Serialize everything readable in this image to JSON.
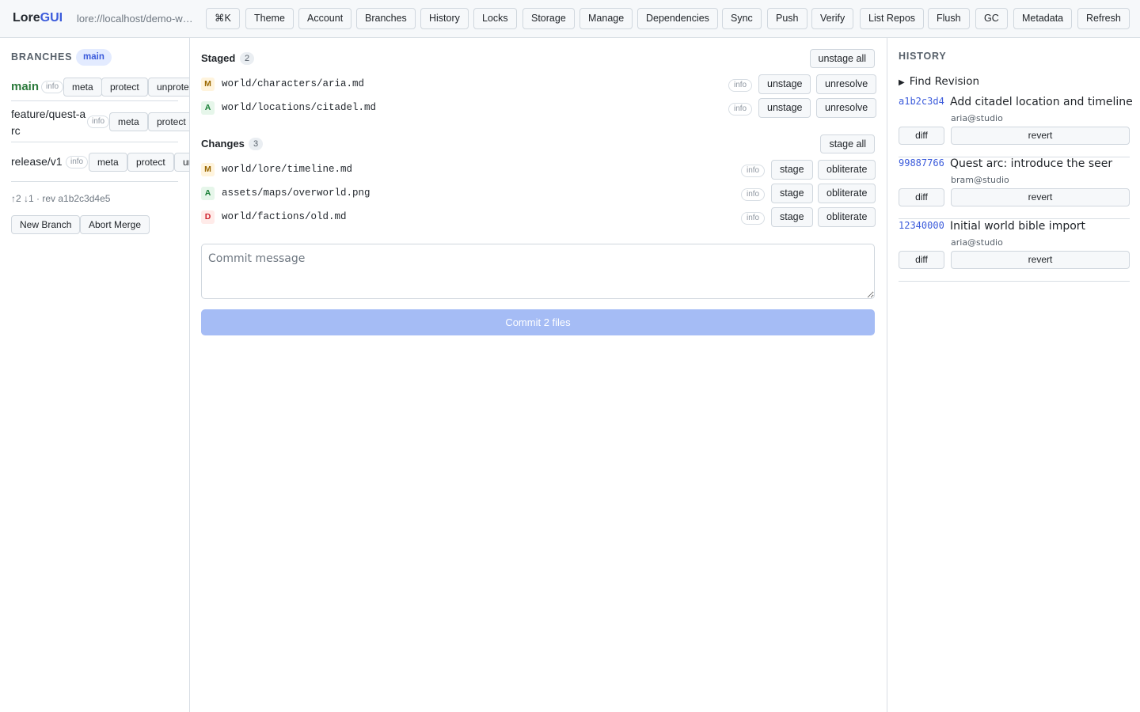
{
  "app": {
    "logo_main": "Lore",
    "logo_accent": "GUI",
    "repo_url": "lore://localhost/demo-world"
  },
  "toolbar": {
    "buttons": [
      "⌘K",
      "Theme",
      "Account",
      "Branches",
      "History",
      "Locks",
      "Storage",
      "Manage",
      "Dependencies",
      "Sync",
      "Push",
      "Verify",
      "List Repos",
      "Flush",
      "GC",
      "Metadata",
      "Refresh"
    ]
  },
  "sidebar": {
    "title": "BRANCHES",
    "current_branch_pill": "main",
    "branches": [
      {
        "name": "main",
        "info": "info",
        "actions": [
          "meta",
          "protect",
          "unprotect"
        ]
      },
      {
        "name": "feature/quest-arc",
        "info": "info",
        "actions": [
          "meta",
          "protect"
        ]
      },
      {
        "name": "release/v1",
        "info": "info",
        "actions": [
          "meta",
          "protect",
          "unprotect"
        ]
      }
    ],
    "status": "↑2 ↓1 · rev a1b2c3d4e5",
    "actions": [
      "New Branch",
      "Abort Merge"
    ]
  },
  "main": {
    "staged": {
      "title": "Staged",
      "count": "2",
      "group_action": "unstage all",
      "files": [
        {
          "status": "M",
          "path": "world/characters/aria.md",
          "info": "info",
          "actions": [
            "unstage",
            "unresolve"
          ]
        },
        {
          "status": "A",
          "path": "world/locations/citadel.md",
          "info": "info",
          "actions": [
            "unstage",
            "unresolve"
          ]
        }
      ]
    },
    "changes": {
      "title": "Changes",
      "count": "3",
      "group_action": "stage all",
      "files": [
        {
          "status": "M",
          "path": "world/lore/timeline.md",
          "info": "info",
          "actions": [
            "stage",
            "obliterate"
          ]
        },
        {
          "status": "A",
          "path": "assets/maps/overworld.png",
          "info": "info",
          "actions": [
            "stage",
            "obliterate"
          ]
        },
        {
          "status": "D",
          "path": "world/factions/old.md",
          "info": "info",
          "actions": [
            "stage",
            "obliterate"
          ]
        }
      ]
    },
    "commit": {
      "placeholder": "Commit message",
      "button_label": "Commit 2 files"
    }
  },
  "history": {
    "title": "HISTORY",
    "find_label": "Find Revision",
    "revisions": [
      {
        "hash": "a1b2c3d4",
        "message": "Add citadel location and timeline",
        "author": "aria@studio",
        "diff": "diff",
        "revert": "revert"
      },
      {
        "hash": "99887766",
        "message": "Quest arc: introduce the seer",
        "author": "bram@studio",
        "diff": "diff",
        "revert": "revert"
      },
      {
        "hash": "12340000",
        "message": "Initial world bible import",
        "author": "aria@studio",
        "diff": "diff",
        "revert": "revert"
      }
    ]
  }
}
